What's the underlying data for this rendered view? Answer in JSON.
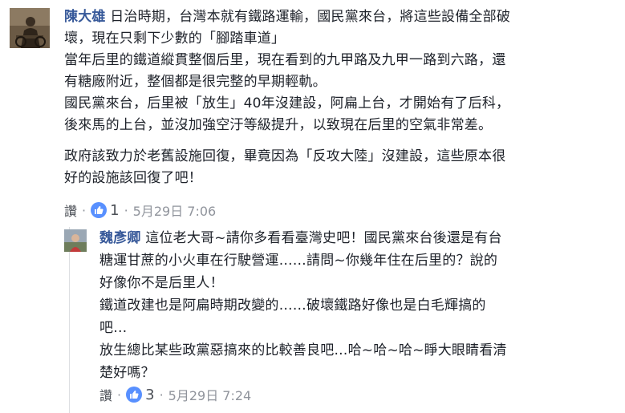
{
  "comments": [
    {
      "author": "陳大雄",
      "paragraphs": [
        [
          "日治時期，台灣本就有鐵路運輸，國民黨來台，將這些設備全部破",
          "壞，現在只剩下少數的「腳踏車道」"
        ],
        [
          "當年后里的鐵道縱貫整個后里，現在看到的九甲路及九甲一路到六路，還",
          "有糖廠附近，整個都是很完整的早期輕軌。"
        ],
        [
          "國民黨來台，后里被「放生」40年沒建設，阿扁上台，才開始有了后科，",
          "後來馬的上台，並沒加強空汙等級提升，以致現在后里的空氣非常差。"
        ],
        [
          "政府該致力於老舊設施回復，畢竟因為「反攻大陸」沒建設，這些原本很",
          "好的設施該回復了吧！"
        ]
      ],
      "like_label": "讚",
      "like_count": "1",
      "timestamp": "5月29日 7:06"
    },
    {
      "author": "魏彥卿",
      "paragraphs": [
        [
          "這位老大哥~請你多看看臺灣史吧！國民黨來台後還是有台",
          "糖運甘蔗的小火車在行駛營運……請問~你幾年住在后里的？說的",
          "好像你不是后里人！",
          "鐵道改建也是阿扁時期改變的……破壞鐵路好像也是白毛輝搞的",
          "吧…",
          "放生總比某些政黨惡搞來的比較善良吧…哈~哈~哈~睜大眼睛看清",
          "楚好嗎？"
        ]
      ],
      "like_label": "讚",
      "like_count": "3",
      "timestamp": "5月29日 7:24"
    }
  ],
  "icons": {
    "like": "thumbs-up-icon",
    "like_color": "#5890ff",
    "name_color": "#365899"
  }
}
